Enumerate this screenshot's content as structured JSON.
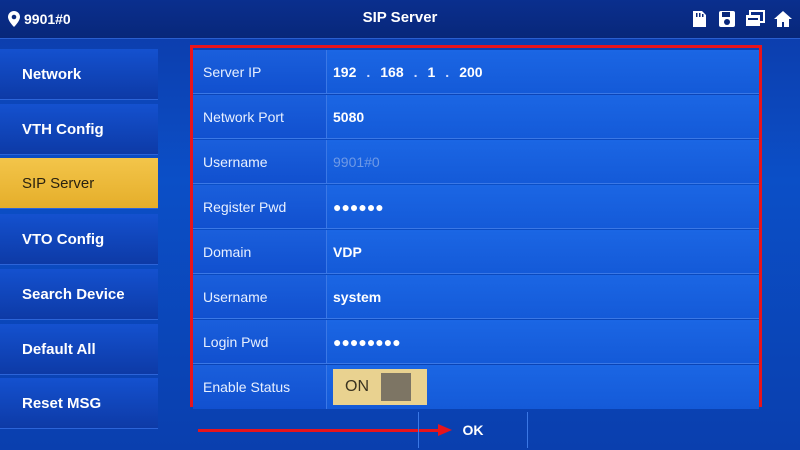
{
  "header": {
    "room": "9901#0",
    "title": "SIP Server"
  },
  "sidebar": {
    "items": [
      {
        "label": "Network"
      },
      {
        "label": "VTH Config"
      },
      {
        "label": "SIP Server"
      },
      {
        "label": "VTO Config"
      },
      {
        "label": "Search Device"
      },
      {
        "label": "Default All"
      },
      {
        "label": "Reset MSG"
      }
    ],
    "active_index": 2
  },
  "form": {
    "server_ip": {
      "label": "Server IP",
      "octets": [
        "192",
        "168",
        "1",
        "200"
      ]
    },
    "network_port": {
      "label": "Network Port",
      "value": "5080"
    },
    "username": {
      "label": "Username",
      "value": "9901#0"
    },
    "register_pwd": {
      "label": "Register Pwd",
      "value": "●●●●●●"
    },
    "domain": {
      "label": "Domain",
      "value": "VDP"
    },
    "username2": {
      "label": "Username",
      "value": "system"
    },
    "login_pwd": {
      "label": "Login Pwd",
      "value": "●●●●●●●●"
    },
    "enable_status": {
      "label": "Enable Status",
      "value": "ON"
    }
  },
  "footer": {
    "ok_label": "OK"
  },
  "colors": {
    "highlight_border": "#e8141b",
    "active_tab": "#f3c54a",
    "background": "#0b4fc7"
  },
  "icons": [
    "location-pin-icon",
    "sd-card-icon",
    "save-icon",
    "copy-icon",
    "home-icon"
  ]
}
